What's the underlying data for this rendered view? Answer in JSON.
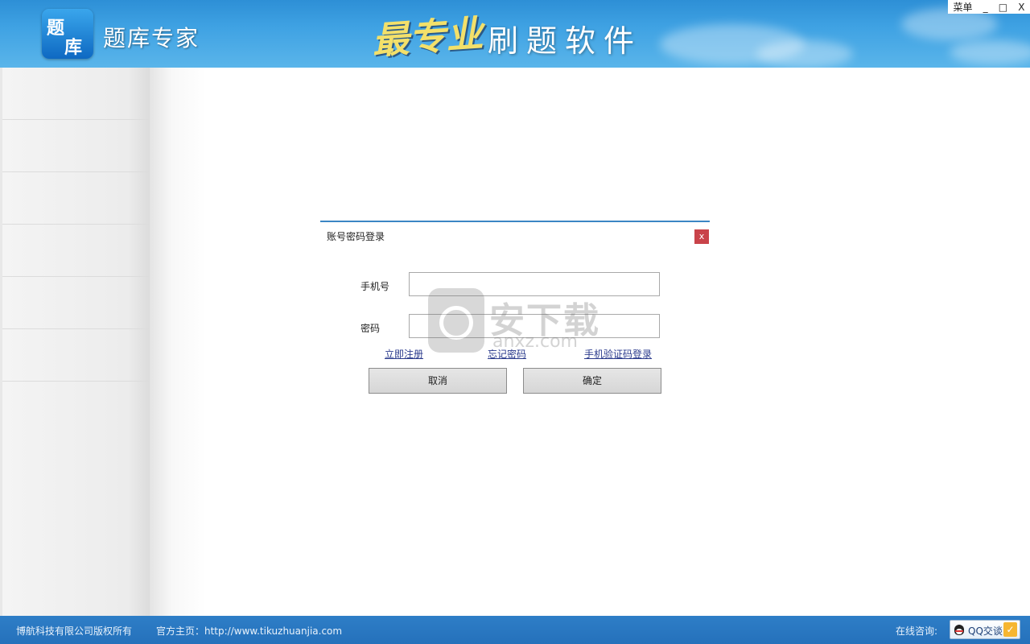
{
  "header": {
    "logo_line1": "题",
    "logo_line2": "库",
    "app_name": "题库专家",
    "slogan_brand": "最专业",
    "slogan_text": "刷题软件"
  },
  "window_controls": {
    "menu": "菜单",
    "minimize": "_",
    "maximize": "□",
    "close": "X"
  },
  "login_dialog": {
    "title": "账号密码登录",
    "close": "x",
    "phone_label": "手机号",
    "phone_value": "",
    "password_label": "密码",
    "password_value": "",
    "link_register": "立即注册",
    "link_forgot": "忘记密码",
    "link_sms_login": "手机验证码登录",
    "cancel_button": "取消",
    "confirm_button": "确定"
  },
  "watermark": {
    "text": "安下载",
    "sub": "anxz.com"
  },
  "footer": {
    "copyright": "博航科技有限公司版权所有",
    "website": "官方主页：http://www.tikuzhuanjia.com",
    "consult_label": "在线咨询:",
    "qq_button": "QQ交谈",
    "qq_check": "✓"
  }
}
